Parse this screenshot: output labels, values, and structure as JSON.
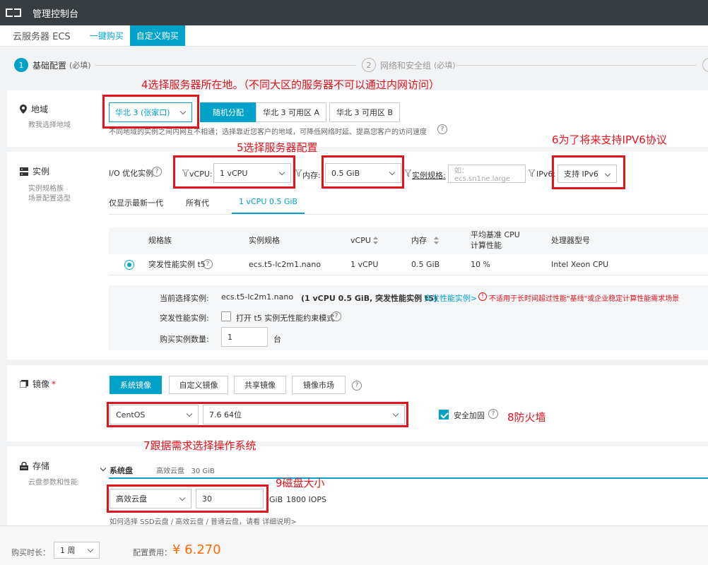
{
  "topbar": {
    "title": "管理控制台"
  },
  "subnav": {
    "product": "云服务器 ECS",
    "tabs": [
      "一键购买",
      "自定义购买"
    ]
  },
  "steps": {
    "s1": {
      "num": "1",
      "label": "基础配置",
      "sub": "(必填)"
    },
    "s2": {
      "num": "2",
      "label": "网络和安全组",
      "sub": "(必填)"
    }
  },
  "region": {
    "title": "地域",
    "hint": "教我选择地域",
    "selected": "华北 3 (张家口)",
    "options": [
      "随机分配",
      "华北 3 可用区 A",
      "华北 3 可用区 B"
    ],
    "note": "不同地域的实例之间内网互不相通；选择靠近您客户的地域，可降低网络时延、提高您客户的访问速度"
  },
  "instance": {
    "title": "实例",
    "hints": [
      "实例规格族",
      "场景配置选型"
    ],
    "io_label": "I/O 优化实例",
    "vcpu_label": "vCPU:",
    "vcpu_value": "1 vCPU",
    "mem_label": "内存:",
    "mem_value": "0.5 GiB",
    "spec_label": "实例规格:",
    "spec_placeholder": "如：ecs.sn1ne.large",
    "ipv6_label": "IPv6:",
    "ipv6_value": "支持 IPv6",
    "gen_tabs": [
      "仅显示最新一代",
      "所有代",
      "1 vCPU 0.5 GiB"
    ],
    "columns": [
      "规格族",
      "实例规格",
      "vCPU",
      "内存",
      "平均基准 CPU",
      "计算性能",
      "处理器型号"
    ],
    "row": {
      "family": "突发性能实例 t5",
      "spec": "ecs.t5-lc2m1.nano",
      "vcpu": "1 vCPU",
      "mem": "0.5 GiB",
      "perf": "10 %",
      "cpu": "Intel Xeon CPU"
    },
    "current_label": "当前选择实例:",
    "current_spec": "ecs.t5-lc2m1.nano",
    "current_detail": "(1 vCPU 0.5 GiB, 突发性能实例 t5)",
    "burst_link": "突发性能实例>",
    "warning": "不适用于长时间超过性能\"基线\"或企业稳定计算性能需求场景",
    "burst_label": "突发性能实例:",
    "burst_option": "打开 t5 实例无性能约束模式",
    "qty_label": "购买实例数量:",
    "qty_value": "1",
    "qty_unit": "台"
  },
  "image": {
    "title": "镜像",
    "required": "*",
    "tabs": [
      "系统镜像",
      "自定义镜像",
      "共享镜像",
      "镜像市场"
    ],
    "os": "CentOS",
    "version": "7.6 64位",
    "security": "安全加固"
  },
  "storage": {
    "title": "存储",
    "hint": "云盘参数和性能",
    "sys_disk": "系统盘",
    "sys_disk_info": "高效云盘   30 GiB",
    "disk_type": "高效云盘",
    "disk_size": "30",
    "disk_unit": "GiB",
    "iops": "1800 IOPS",
    "help": "如何选择 SSD云盘 / 高效云盘 / 普通云盘，请看 详细说明>"
  },
  "footer": {
    "duration_label": "购买时长：",
    "duration_value": "1 周",
    "cost_label": "配置费用：",
    "price": "¥ 6.270"
  },
  "annotations": {
    "a4": "4选择服务器所在地。（不同大区的服务器不可以通过内网访问）",
    "a5": "5选择服务器配置",
    "a6": "6为了将来支持IPV6协议",
    "a7": "7跟据需求选择操作系统",
    "a8": "8防火墙",
    "a9": "9磁盘大小"
  },
  "colors": {
    "accent": "#00a2ca",
    "annotation": "#e4121c",
    "price": "#ff6a00",
    "topbar": "#373d41"
  }
}
